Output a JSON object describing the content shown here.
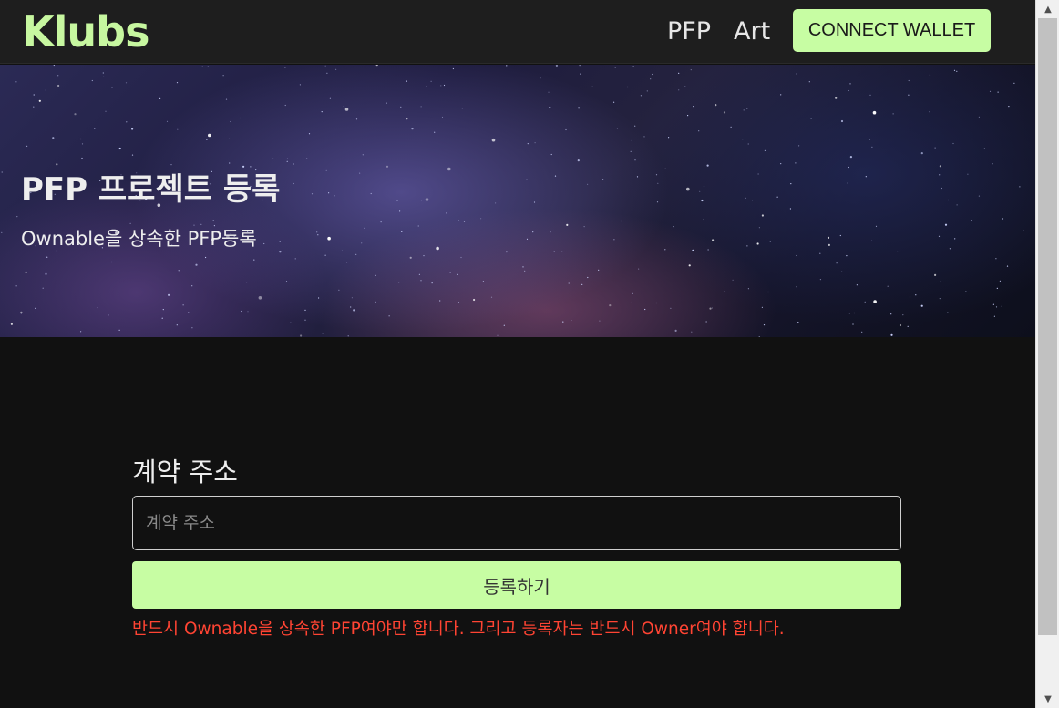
{
  "header": {
    "logo": "Klubs",
    "nav": [
      {
        "label": "PFP"
      },
      {
        "label": "Art"
      }
    ],
    "connect_wallet": "CONNECT WALLET"
  },
  "hero": {
    "title": "PFP 프로젝트 등록",
    "subtitle": "Ownable을 상속한 PFP등록"
  },
  "form": {
    "label": "계약 주소",
    "input_placeholder": "계약 주소",
    "input_value": "",
    "submit_label": "등록하기",
    "warning": "반드시 Ownable을 상속한 PFP여야만 합니다. 그리고 등록자는 반드시 Owner여야 합니다."
  },
  "colors": {
    "accent": "#c7fda3",
    "logo": "#c7f7a0",
    "warning": "#ff4433",
    "background": "#111111",
    "header_background": "#1e1e1e"
  },
  "icons": {
    "scroll_up": "scroll-up-arrow-icon",
    "scroll_down": "scroll-down-arrow-icon"
  }
}
